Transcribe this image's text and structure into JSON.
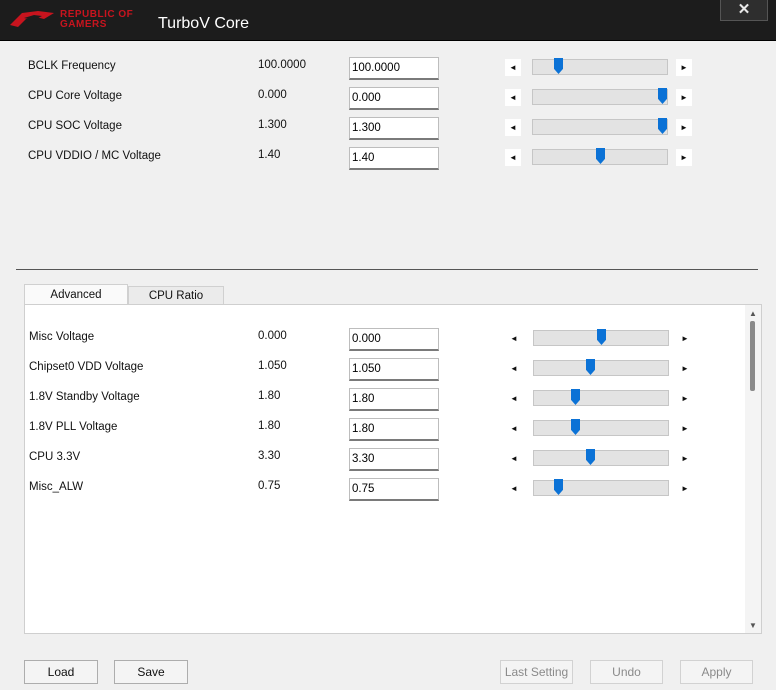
{
  "window": {
    "logo_text": "REPUBLIC OF\nGAMERS",
    "title": "TurboV Core",
    "close_label": "✕"
  },
  "top_settings": [
    {
      "label": "BCLK Frequency",
      "value": "100.0000",
      "input": "100.0000",
      "slider": 0.19
    },
    {
      "label": "CPU Core Voltage",
      "value": "0.000",
      "input": "0.000",
      "slider": 0.97
    },
    {
      "label": "CPU SOC Voltage",
      "value": "1.300",
      "input": "1.300",
      "slider": 0.97
    },
    {
      "label": "CPU VDDIO / MC Voltage",
      "value": "1.40",
      "input": "1.40",
      "slider": 0.5
    }
  ],
  "tabs": [
    {
      "label": "Advanced",
      "active": true
    },
    {
      "label": "CPU Ratio",
      "active": false
    }
  ],
  "advanced_settings": [
    {
      "label": "Misc Voltage",
      "value": "0.000",
      "input": "0.000",
      "slider": 0.5
    },
    {
      "label": "Chipset0 VDD Voltage",
      "value": "1.050",
      "input": "1.050",
      "slider": 0.42
    },
    {
      "label": "1.8V Standby Voltage",
      "value": "1.80",
      "input": "1.80",
      "slider": 0.31
    },
    {
      "label": "1.8V PLL Voltage",
      "value": "1.80",
      "input": "1.80",
      "slider": 0.31
    },
    {
      "label": "CPU 3.3V",
      "value": "3.30",
      "input": "3.30",
      "slider": 0.42
    },
    {
      "label": "Misc_ALW",
      "value": "0.75",
      "input": "0.75",
      "slider": 0.18
    }
  ],
  "arrows": {
    "left": "◄",
    "right": "►",
    "up": "▲",
    "down": "▼"
  },
  "buttons": {
    "load": "Load",
    "save": "Save",
    "last_setting": "Last Setting",
    "undo": "Undo",
    "apply": "Apply"
  },
  "colors": {
    "accent": "#0b72d6",
    "brand": "#c8141e"
  }
}
